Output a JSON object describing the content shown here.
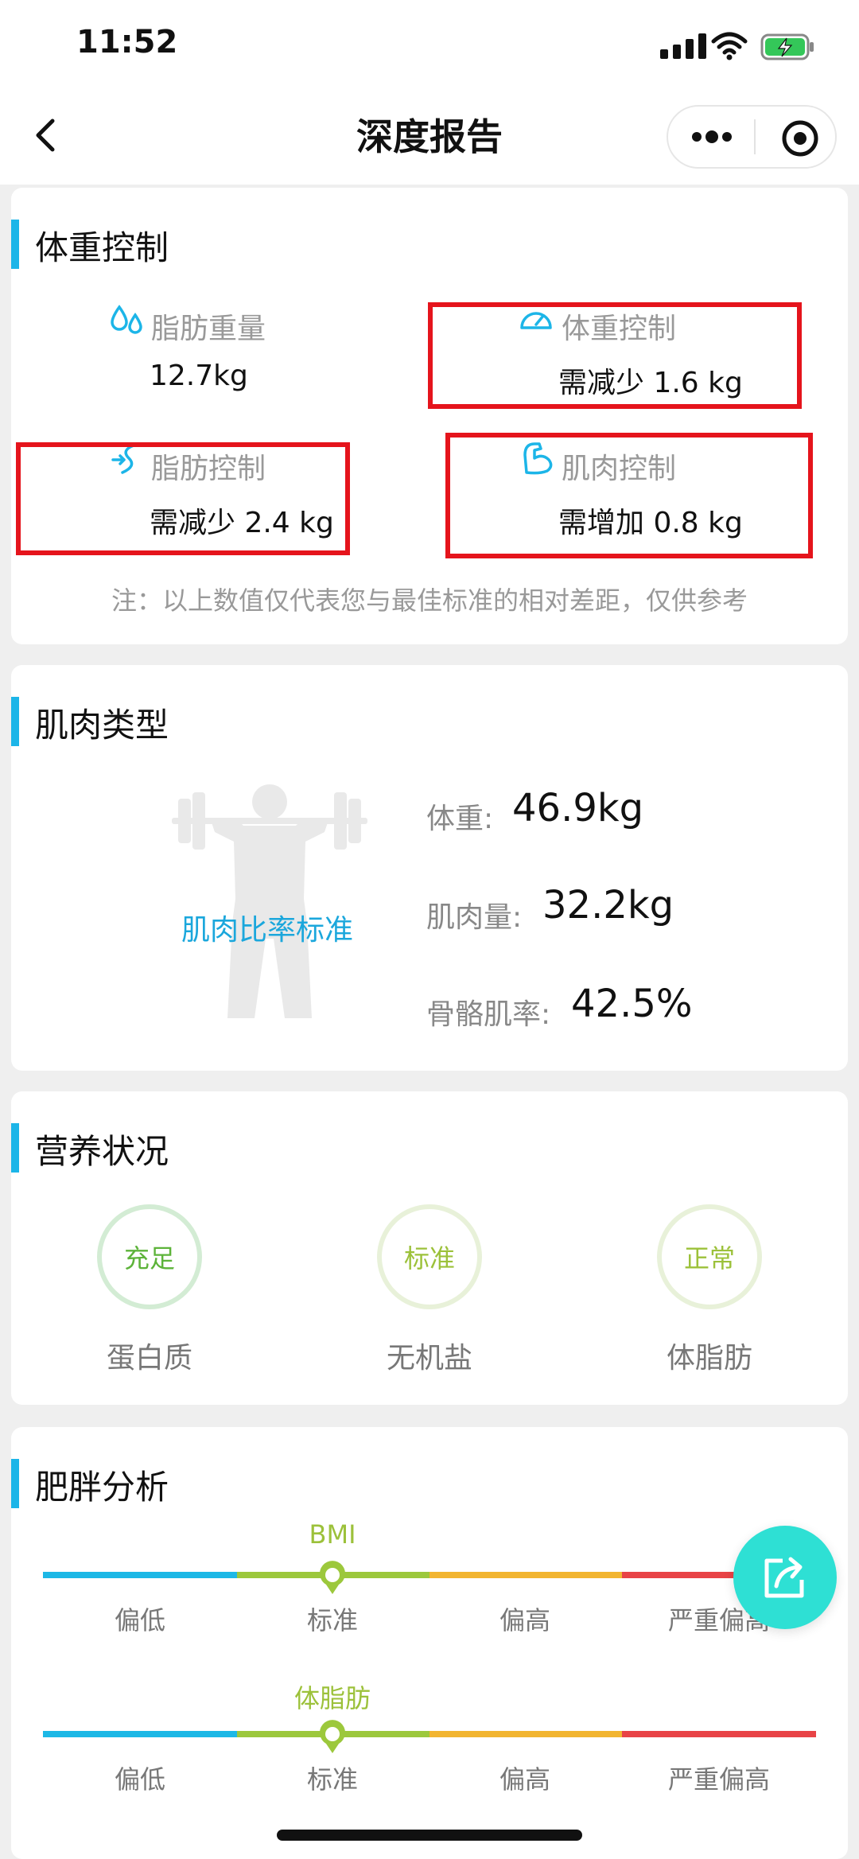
{
  "status": {
    "time": "11:52"
  },
  "nav": {
    "title": "深度报告"
  },
  "weight_control": {
    "title": "体重控制",
    "items": [
      {
        "label": "脂肪重量",
        "value": "12.7kg",
        "icon": "water-drops-icon"
      },
      {
        "label": "体重控制",
        "value": "需减少 1.6 kg",
        "icon": "gauge-icon"
      },
      {
        "label": "脂肪控制",
        "value": "需减少 2.4 kg",
        "icon": "fat-arrow-icon"
      },
      {
        "label": "肌肉控制",
        "value": "需增加 0.8 kg",
        "icon": "muscle-arm-icon"
      }
    ],
    "note": "注：以上数值仅代表您与最佳标准的相对差距，仅供参考"
  },
  "muscle_type": {
    "title": "肌肉类型",
    "ratio_label": "肌肉比率标准",
    "metrics": [
      {
        "label": "体重:",
        "value": "46.9kg"
      },
      {
        "label": "肌肉量:",
        "value": "32.2kg"
      },
      {
        "label": "骨骼肌率:",
        "value": "42.5%"
      }
    ]
  },
  "nutrition": {
    "title": "营养状况",
    "items": [
      {
        "status": "充足",
        "label": "蛋白质",
        "color": "#5db33a",
        "ring": "#d3ecd4"
      },
      {
        "status": "标准",
        "label": "无机盐",
        "color": "#9cc13a",
        "ring": "#e8f1d9"
      },
      {
        "status": "正常",
        "label": "体脂肪",
        "color": "#9cc13a",
        "ring": "#e8f1d9"
      }
    ]
  },
  "obesity": {
    "title": "肥胖分析",
    "scale_labels": [
      "偏低",
      "标准",
      "偏高",
      "严重偏高"
    ],
    "scale_colors": [
      "#1cb8e6",
      "#9cc83c",
      "#f2b530",
      "#e84346"
    ],
    "rows": [
      {
        "name": "BMI",
        "level": "标准"
      },
      {
        "name": "体脂肪",
        "level": "标准"
      }
    ]
  }
}
